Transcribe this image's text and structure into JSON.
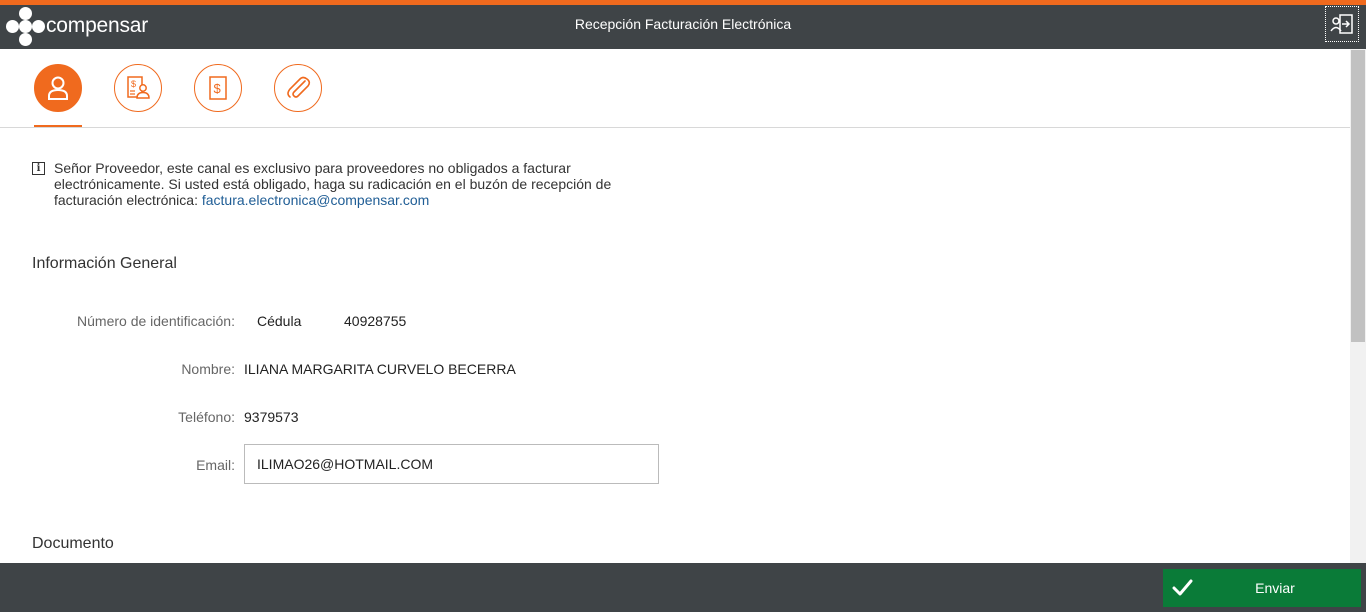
{
  "header": {
    "logo_text": "compensar",
    "title": "Recepción Facturación Electrónica",
    "logout_icon": "logout-icon"
  },
  "steps": [
    {
      "icon": "user-icon",
      "active": true
    },
    {
      "icon": "invoice-person-icon",
      "active": false
    },
    {
      "icon": "dollar-document-icon",
      "active": false
    },
    {
      "icon": "paperclip-icon",
      "active": false
    }
  ],
  "notice": {
    "icon": "info-icon",
    "text": "Señor Proveedor, este canal es exclusivo para proveedores no obligados a facturar electrónicamente. Si usted está obligado, haga su radicación en el buzón de recepción de facturación electrónica: ",
    "link": "factura.electronica@compensar.com"
  },
  "general": {
    "title": "Información General",
    "id_label": "Número de identificación:",
    "id_type": "Cédula",
    "id_number": "40928755",
    "name_label": "Nombre:",
    "name": "ILIANA MARGARITA CURVELO BECERRA",
    "phone_label": "Teléfono:",
    "phone": "9379573",
    "email_label": "Email:",
    "email": "ILIMAO26@HOTMAIL.COM"
  },
  "document": {
    "title": "Documento"
  },
  "footer": {
    "send_label": "Enviar",
    "send_icon": "check-icon"
  },
  "colors": {
    "accent": "#f06a1e",
    "bar": "#3f4447",
    "send": "#0a7b38",
    "link": "#1f5d95"
  }
}
